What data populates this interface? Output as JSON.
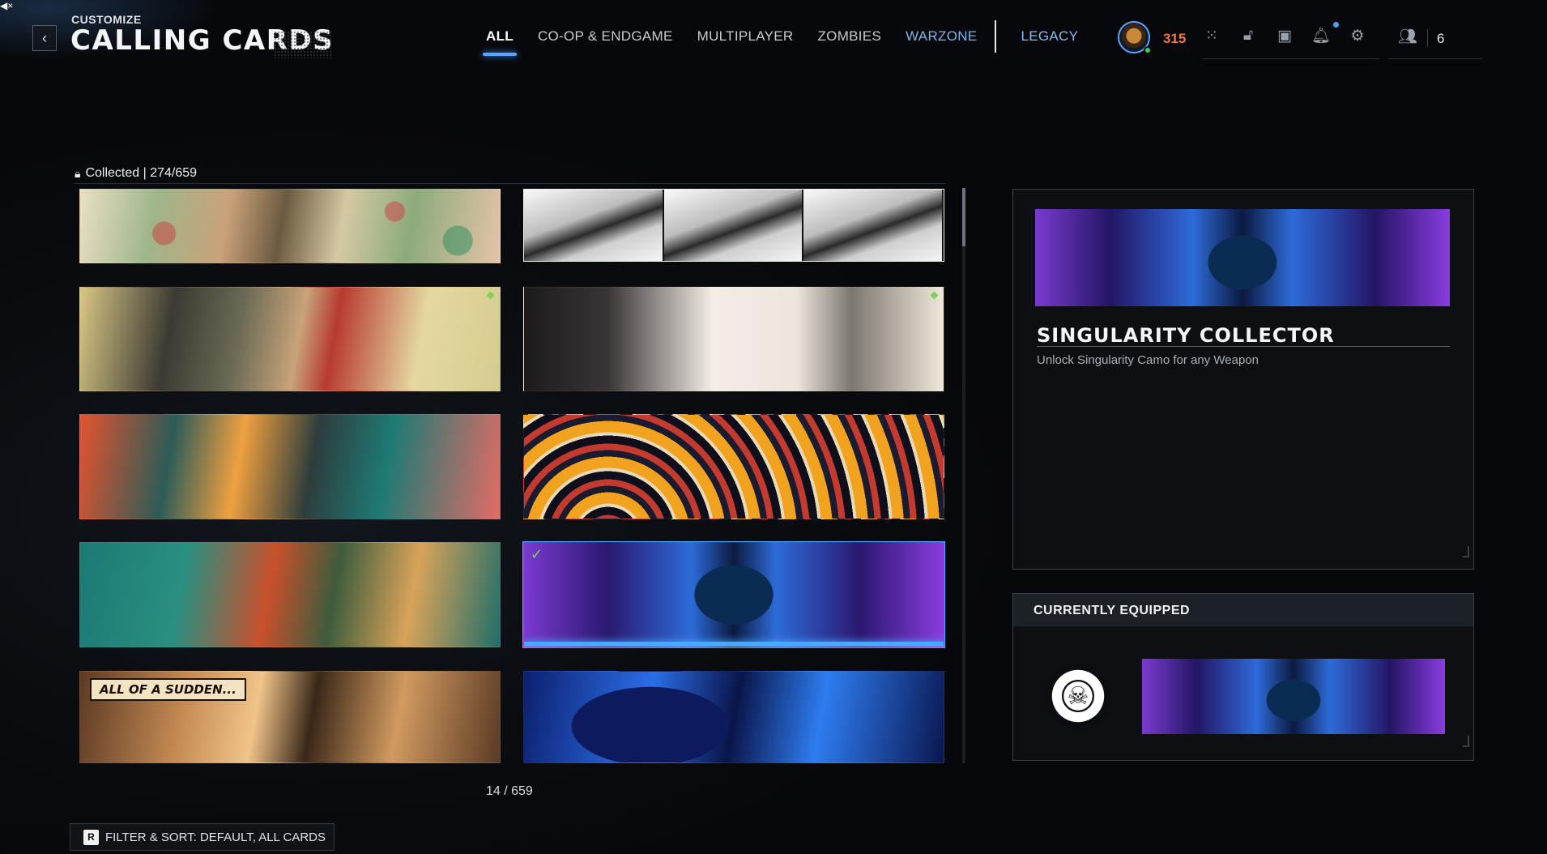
{
  "header": {
    "eyebrow": "CUSTOMIZE",
    "title": "CALLING CARDS",
    "back_glyph": "‹"
  },
  "nav": {
    "tabs": [
      {
        "label": "ALL",
        "active": true
      },
      {
        "label": "CO-OP & ENDGAME"
      },
      {
        "label": "MULTIPLAYER"
      },
      {
        "label": "ZOMBIES"
      },
      {
        "label": "WARZONE"
      }
    ],
    "legacy": "LEGACY"
  },
  "player": {
    "level": "315",
    "friends_count": "6",
    "icons": [
      "apps-grid-icon",
      "unlock-icon",
      "store-icon",
      "bell-icon",
      "gear-icon",
      "friends-icon"
    ]
  },
  "collection": {
    "label": "Collected | 274/659",
    "counter": "14 / 659"
  },
  "cards": [
    {
      "name": "card-garden-soldier"
    },
    {
      "name": "card-black-white-soldiers"
    },
    {
      "name": "card-old-soldier-mirror"
    },
    {
      "name": "card-cat-pigeons"
    },
    {
      "name": "card-rocket-soldier"
    },
    {
      "name": "card-tribal-pattern"
    },
    {
      "name": "card-bearded-soldier"
    },
    {
      "name": "card-singularity-collector",
      "equipped": true
    },
    {
      "name": "card-all-of-a-sudden",
      "caption": "ALL OF A SUDDEN..."
    },
    {
      "name": "card-blue-warrior"
    }
  ],
  "detail": {
    "title": "SINGULARITY COLLECTOR",
    "description": "Unlock Singularity Camo for any Weapon"
  },
  "equipped": {
    "title": "CURRENTLY EQUIPPED"
  },
  "footer": {
    "key": "R",
    "filter_label": "FILTER & SORT: DEFAULT, ALL CARDS"
  },
  "colors": {
    "accent": "#5aa6ff",
    "level": "#f0783a",
    "equipped_check": "#7cd35a"
  }
}
